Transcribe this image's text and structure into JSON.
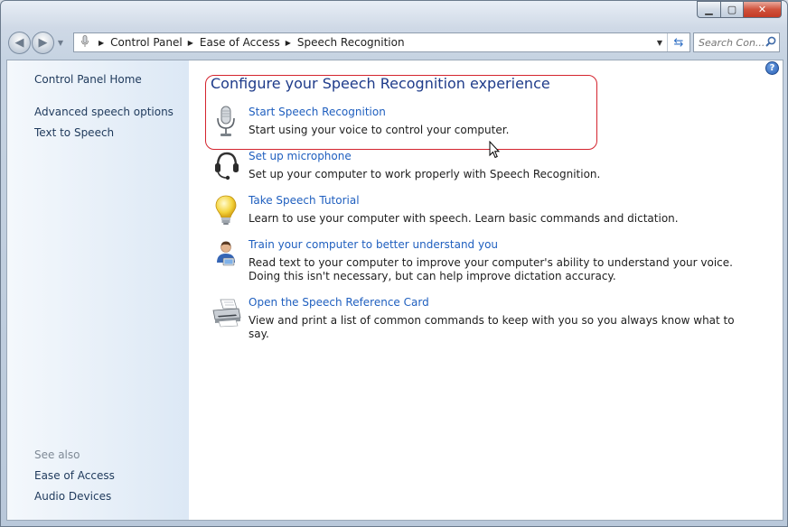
{
  "window": {
    "caption": {
      "minimize": "▁",
      "maximize": "▢",
      "close": "✕"
    }
  },
  "navigation": {
    "breadcrumb": [
      "Control Panel",
      "Ease of Access",
      "Speech Recognition"
    ],
    "search_placeholder": "Search Con..."
  },
  "sidebar": {
    "home": "Control Panel Home",
    "links": [
      "Advanced speech options",
      "Text to Speech"
    ],
    "see_also_heading": "See also",
    "see_also": [
      "Ease of Access",
      "Audio Devices"
    ]
  },
  "main": {
    "title": "Configure your Speech Recognition experience",
    "tasks": [
      {
        "icon": "microphone-icon",
        "link": "Start Speech Recognition",
        "desc": "Start using your voice to control your computer."
      },
      {
        "icon": "headset-icon",
        "link": "Set up microphone",
        "desc": "Set up your computer to work properly with Speech Recognition."
      },
      {
        "icon": "lightbulb-icon",
        "link": "Take Speech Tutorial",
        "desc": "Learn to use your computer with speech.  Learn basic commands and dictation."
      },
      {
        "icon": "user-training-icon",
        "link": "Train your computer to better understand you",
        "desc": "Read text to your computer to improve your computer's ability to understand your voice.  Doing this isn't necessary, but can help improve dictation accuracy."
      },
      {
        "icon": "printer-icon",
        "link": "Open the Speech Reference Card",
        "desc": "View and print a list of common commands to keep with you so you always know what to say."
      }
    ]
  },
  "help": "?",
  "colors": {
    "link": "#1f5fbf",
    "title": "#1e3b8a",
    "highlight_border": "#d4242e"
  }
}
